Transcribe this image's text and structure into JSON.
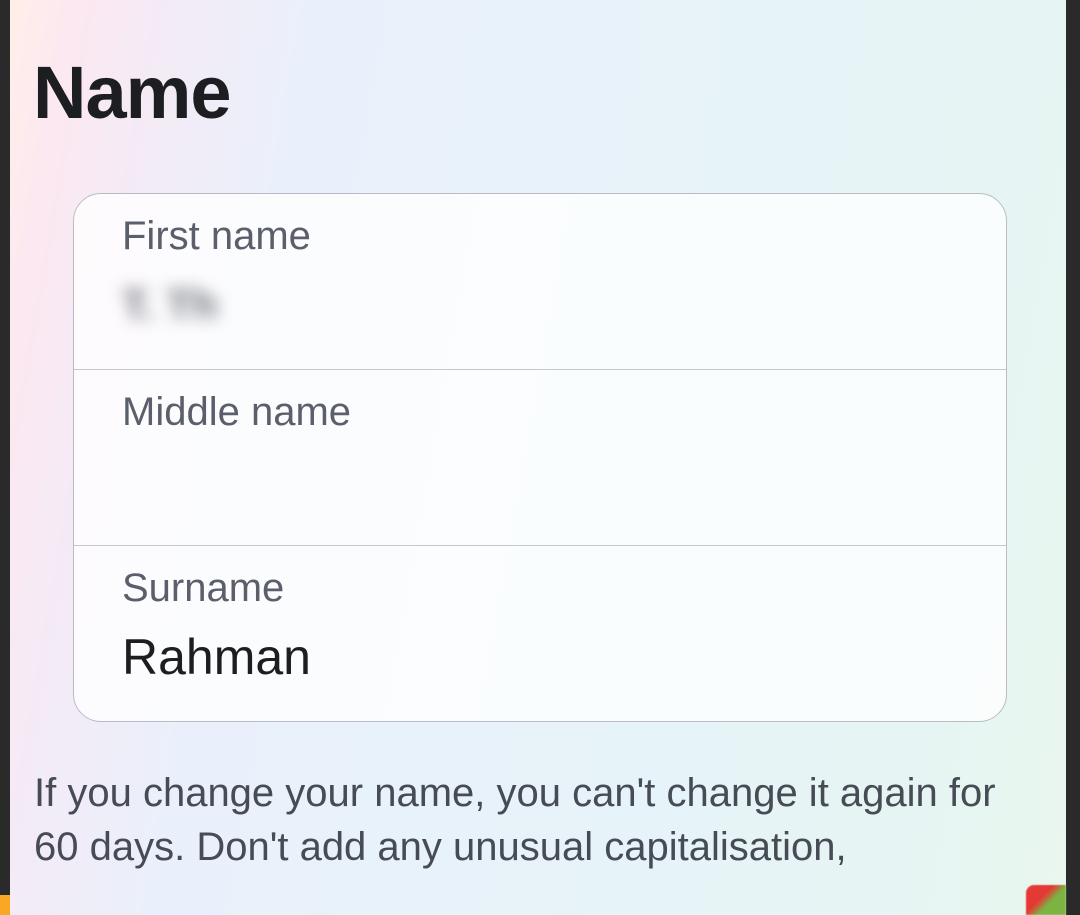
{
  "page": {
    "title": "Name"
  },
  "form": {
    "first_name": {
      "label": "First name",
      "value": "T. Th"
    },
    "middle_name": {
      "label": "Middle name",
      "value": ""
    },
    "surname": {
      "label": "Surname",
      "value": "Rahman"
    }
  },
  "helper": "If you change your name, you can't change it again for 60 days. Don't add any unusual capitalisation,"
}
